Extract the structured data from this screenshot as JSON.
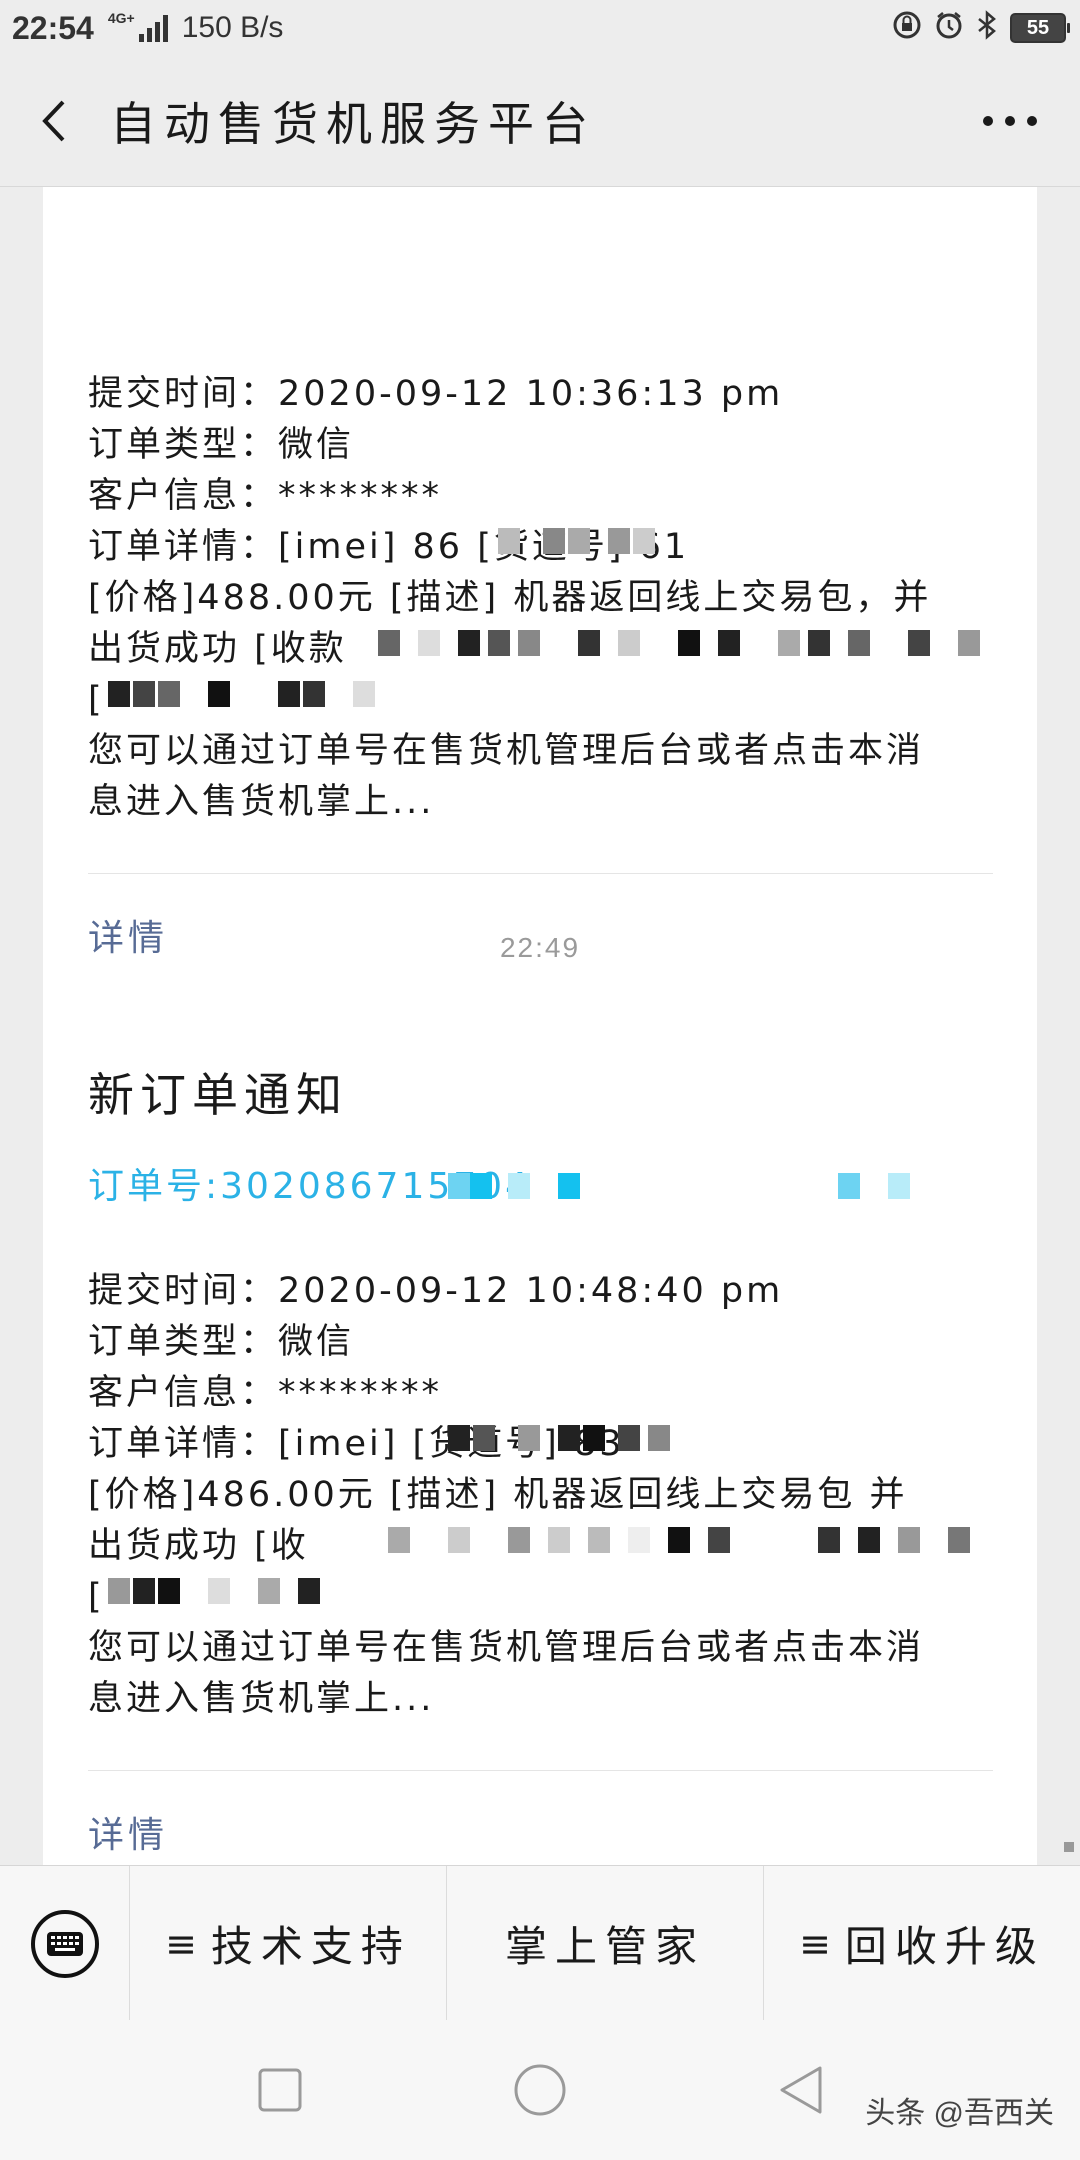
{
  "status_bar": {
    "time": "22:54",
    "network_type": "4G+",
    "net_speed": "150 B/s",
    "battery": "55",
    "icons": [
      "lock-rotate-icon",
      "alarm-icon",
      "bluetooth-icon",
      "battery-icon"
    ]
  },
  "header": {
    "title": "自动售货机服务平台",
    "back_icon": "chevron-left-icon",
    "more_icon": "more-dots-icon"
  },
  "messages": [
    {
      "title": "",
      "order_no": "",
      "fields": [
        {
          "key": "提交时间：",
          "value": "2020-09-12 10:36:13 pm"
        },
        {
          "key": "订单类型：",
          "value": "微信"
        },
        {
          "key": "客户信息：",
          "value": "********"
        },
        {
          "key": "订单详情：",
          "value": "[imei] 86                    [货道号] 61"
        },
        {
          "key": "",
          "value": "[价格]488.00元 [描述] 机器返回线上交易包，并"
        },
        {
          "key": "",
          "value": "出货成功 [收款"
        },
        {
          "key": "",
          "value": "["
        },
        {
          "key": "",
          "value": "您可以通过订单号在售货机管理后台或者点击本消"
        },
        {
          "key": "",
          "value": "息进入售货机掌上..."
        }
      ],
      "detail_label": "详情"
    },
    {
      "title": "新订单通知",
      "order_no": "订单号:302086715704",
      "fields": [
        {
          "key": "提交时间：",
          "value": "2020-09-12 10:48:40 pm"
        },
        {
          "key": "订单类型：",
          "value": "微信"
        },
        {
          "key": "客户信息：",
          "value": "********"
        },
        {
          "key": "订单详情：",
          "value": "[imei]                        [货道号] 83"
        },
        {
          "key": "",
          "value": "[价格]486.00元 [描述] 机器返回线上交易包     并"
        },
        {
          "key": "",
          "value": "出货成功 [收"
        },
        {
          "key": "",
          "value": "["
        },
        {
          "key": "",
          "value": "您可以通过订单号在售货机管理后台或者点击本消"
        },
        {
          "key": "",
          "value": "息进入售货机掌上..."
        }
      ],
      "detail_label": "详情"
    }
  ],
  "time_separator": "22:49",
  "bottom_menu": {
    "keyboard_icon": "keyboard-icon",
    "items": [
      {
        "label": "技术支持",
        "has_submenu": true
      },
      {
        "label": "掌上管家",
        "has_submenu": false
      },
      {
        "label": "回收升级",
        "has_submenu": true
      }
    ],
    "submenu_glyph": "≡"
  },
  "nav_bar": {
    "buttons": [
      "recents-square-icon",
      "home-circle-icon",
      "back-triangle-icon"
    ]
  },
  "watermark": "头条 @吾西关",
  "colors": {
    "background": "#ededed",
    "card": "#ffffff",
    "link": "#576b95",
    "order_no": "#2bb2e6"
  }
}
